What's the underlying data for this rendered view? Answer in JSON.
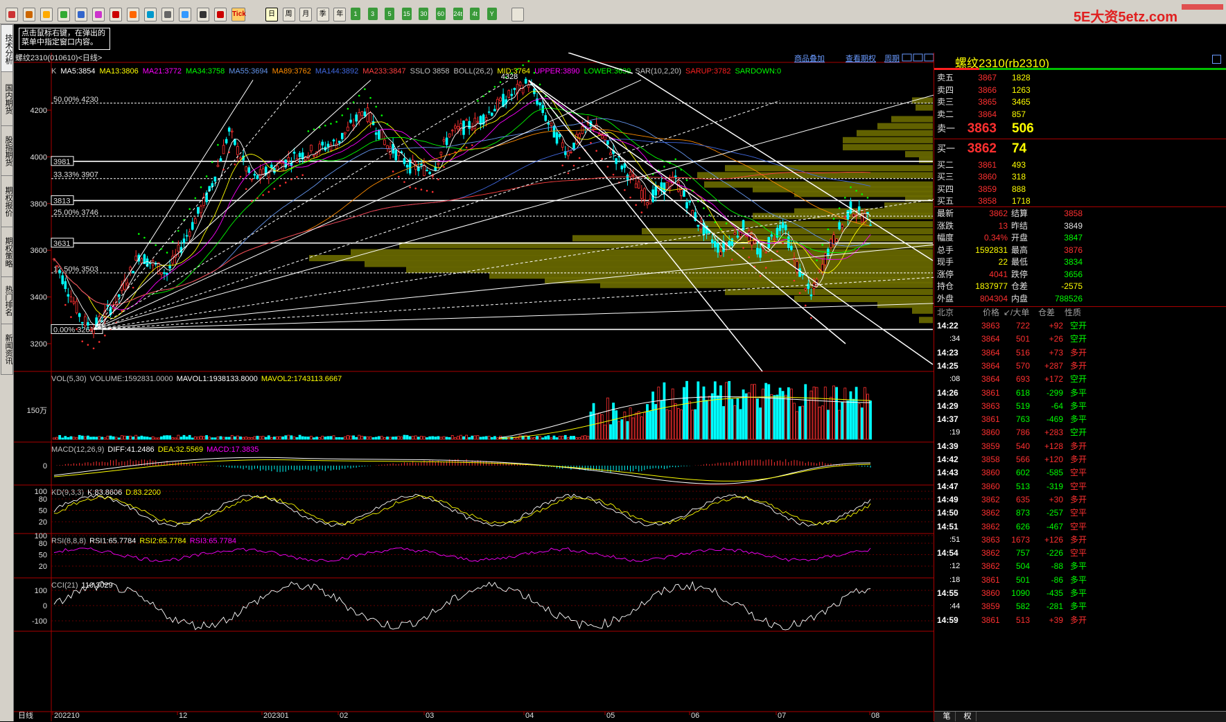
{
  "toolbar": {
    "icons": [
      "home-icon",
      "book-icon",
      "disk-icon",
      "refresh-icon",
      "zoom-in-icon",
      "zoom-out-icon",
      "draw-icon",
      "pen-icon",
      "filter-icon",
      "cursor-icon",
      "new-icon",
      "table-icon",
      "chart-icon",
      "tick-icon"
    ],
    "tick_label": "Tick",
    "periods": [
      "日",
      "周",
      "月",
      "季",
      "年",
      "1",
      "3",
      "5",
      "15",
      "30",
      "60",
      "24t",
      "4t",
      "Y"
    ],
    "brand": "5E大资5etz.com"
  },
  "left_tabs": [
    "技术分析",
    "国内期货",
    "股指期货",
    "期权报价",
    "期权策略",
    "热门排名",
    "新闻资讯"
  ],
  "tooltip": "点击鼠标右键，在弹出的菜单中指定窗口内容。",
  "chart": {
    "title": "螺纹2310(010610)<日线>",
    "top_links": [
      "商品叠加",
      "查看期权",
      "周期"
    ],
    "indicator_line": [
      {
        "text": "K",
        "color": "#c0c0c0"
      },
      {
        "text": "MA5:3854",
        "color": "#ffffff"
      },
      {
        "text": "MA13:3806",
        "color": "#ffff00"
      },
      {
        "text": "MA21:3772",
        "color": "#ff00ff"
      },
      {
        "text": "MA34:3758",
        "color": "#00ff00"
      },
      {
        "text": "MA55:3694",
        "color": "#6495ed"
      },
      {
        "text": "MA89:3762",
        "color": "#ff8c00"
      },
      {
        "text": "MA144:3892",
        "color": "#4169e1"
      },
      {
        "text": "MA233:3847",
        "color": "#ff4040"
      },
      {
        "text": "SSLO 3858",
        "color": "#c0c0c0"
      },
      {
        "text": "BOLL(26,2)",
        "color": "#c0c0c0"
      },
      {
        "text": "MID:3764",
        "color": "#ffff00"
      },
      {
        "text": "UPPER:3890",
        "color": "#ff00ff"
      },
      {
        "text": "LOWER:3639",
        "color": "#00ff00"
      },
      {
        "text": "SAR(10,2,20)",
        "color": "#c0c0c0"
      },
      {
        "text": "SARUP:3782",
        "color": "#ff2020"
      },
      {
        "text": "SARDOWN:0",
        "color": "#00ff00"
      }
    ],
    "price_axis": [
      "4200",
      "4000",
      "3800",
      "3600",
      "3400",
      "3200"
    ],
    "fib_labels": [
      "50.00% 4230",
      "3981",
      "33.33% 3907",
      "3813",
      "25.00% 3746",
      "3631",
      "12.50% 3503",
      "0.00% 3261"
    ],
    "fib_prices": [
      4230,
      3981,
      3907,
      3813,
      3746,
      3631,
      3503,
      3261
    ],
    "high_label": "4328",
    "high_price": 4328,
    "low_price": 3261,
    "date_axis": [
      "日线",
      "202210",
      "12",
      "202301",
      "02",
      "03",
      "04",
      "05",
      "06",
      "07",
      "08"
    ],
    "vol": {
      "title": "VOL(5,30)",
      "parts": [
        {
          "text": "VOL(5,30)",
          "color": "#c0c0c0"
        },
        {
          "text": "VOLUME:1592831.0000",
          "color": "#c0c0c0"
        },
        {
          "text": "MAVOL1:1938133.8000",
          "color": "#ffffff"
        },
        {
          "text": "MAVOL2:1743113.6667",
          "color": "#ffff00"
        }
      ],
      "axis": "150万"
    },
    "macd": {
      "parts": [
        {
          "text": "MACD(12,26,9)",
          "color": "#c0c0c0"
        },
        {
          "text": "DIFF:41.2486",
          "color": "#ffffff"
        },
        {
          "text": "DEA:32.5569",
          "color": "#ffff00"
        },
        {
          "text": "MACD:17.3835",
          "color": "#ff00ff"
        }
      ],
      "axis": "0"
    },
    "kd": {
      "parts": [
        {
          "text": "KD(9,3,3)",
          "color": "#c0c0c0"
        },
        {
          "text": "K:83.8606",
          "color": "#ffffff"
        },
        {
          "text": "D:83.2200",
          "color": "#ffff00"
        }
      ],
      "axis": [
        "100",
        "80",
        "50",
        "20"
      ]
    },
    "rsi": {
      "parts": [
        {
          "text": "RSI(8,8,8)",
          "color": "#c0c0c0"
        },
        {
          "text": "RSI1:65.7784",
          "color": "#ffffff"
        },
        {
          "text": "RSI2:65.7784",
          "color": "#ffff00"
        },
        {
          "text": "RSI3:65.7784",
          "color": "#ff00ff"
        }
      ],
      "axis": [
        "100",
        "80",
        "50",
        "20"
      ]
    },
    "cci": {
      "parts": [
        {
          "text": "CCI(21)",
          "color": "#c0c0c0"
        },
        {
          "text": "110.3029",
          "color": "#ffffff"
        }
      ],
      "axis": [
        "100",
        "0",
        "-100"
      ]
    }
  },
  "panel": {
    "title": "螺纹2310(rb2310)",
    "sells": [
      {
        "label": "卖五",
        "price": "3867",
        "vol": "1828"
      },
      {
        "label": "卖四",
        "price": "3866",
        "vol": "1263"
      },
      {
        "label": "卖三",
        "price": "3865",
        "vol": "3465"
      },
      {
        "label": "卖二",
        "price": "3864",
        "vol": "857"
      },
      {
        "label": "卖一",
        "price": "3863",
        "vol": "506"
      }
    ],
    "buys": [
      {
        "label": "买一",
        "price": "3862",
        "vol": "74"
      },
      {
        "label": "买二",
        "price": "3861",
        "vol": "493"
      },
      {
        "label": "买三",
        "price": "3860",
        "vol": "318"
      },
      {
        "label": "买四",
        "price": "3859",
        "vol": "888"
      },
      {
        "label": "买五",
        "price": "3858",
        "vol": "1718"
      }
    ],
    "stats": [
      {
        "l1": "最新",
        "v1": "3862",
        "c1": "#ff3030",
        "l2": "结算",
        "v2": "3858",
        "c2": "#ff3030"
      },
      {
        "l1": "涨跌",
        "v1": "13",
        "c1": "#ff3030",
        "l2": "昨结",
        "v2": "3849",
        "c2": "#e0e0e0"
      },
      {
        "l1": "幅度",
        "v1": "0.34%",
        "c1": "#ff3030",
        "l2": "开盘",
        "v2": "3847",
        "c2": "#00ff00"
      },
      {
        "l1": "总手",
        "v1": "1592831",
        "c1": "#ffff00",
        "l2": "最高",
        "v2": "3876",
        "c2": "#ff3030"
      },
      {
        "l1": "现手",
        "v1": "22",
        "c1": "#ffff00",
        "l2": "最低",
        "v2": "3834",
        "c2": "#00ff00"
      },
      {
        "l1": "涨停",
        "v1": "4041",
        "c1": "#ff3030",
        "l2": "跌停",
        "v2": "3656",
        "c2": "#00ff00"
      },
      {
        "l1": "持仓",
        "v1": "1837977",
        "c1": "#ffff00",
        "l2": "仓差",
        "v2": "-2575",
        "c2": "#ffff00"
      },
      {
        "l1": "外盘",
        "v1": "804304",
        "c1": "#ff3030",
        "l2": "内盘",
        "v2": "788526",
        "c2": "#00ff00"
      }
    ],
    "tick_header": [
      "北京",
      "价格",
      "↙/大单",
      "仓差",
      "性质"
    ],
    "ticks": [
      {
        "t": "14:22",
        "p": "3863",
        "v": "722",
        "d": "+92",
        "n": "空开"
      },
      {
        "t": ":34",
        "p": "3864",
        "v": "501",
        "d": "+26",
        "n": "空开"
      },
      {
        "t": "14:23",
        "p": "3864",
        "v": "516",
        "d": "+73",
        "n": "多开"
      },
      {
        "t": "14:25",
        "p": "3864",
        "v": "570",
        "d": "+287",
        "n": "多开"
      },
      {
        "t": ":08",
        "p": "3864",
        "v": "693",
        "d": "+172",
        "n": "空开"
      },
      {
        "t": "14:26",
        "p": "3861",
        "v": "618",
        "d": "-299",
        "n": "多平"
      },
      {
        "t": "14:29",
        "p": "3863",
        "v": "519",
        "d": "-64",
        "n": "多平"
      },
      {
        "t": "14:37",
        "p": "3861",
        "v": "763",
        "d": "-469",
        "n": "多平"
      },
      {
        "t": ":19",
        "p": "3860",
        "v": "786",
        "d": "+283",
        "n": "空开"
      },
      {
        "t": "14:39",
        "p": "3859",
        "v": "540",
        "d": "+128",
        "n": "多开"
      },
      {
        "t": "14:42",
        "p": "3858",
        "v": "566",
        "d": "+120",
        "n": "多开"
      },
      {
        "t": "14:43",
        "p": "3860",
        "v": "602",
        "d": "-585",
        "n": "空平"
      },
      {
        "t": "14:47",
        "p": "3860",
        "v": "513",
        "d": "-319",
        "n": "空平"
      },
      {
        "t": "14:49",
        "p": "3862",
        "v": "635",
        "d": "+30",
        "n": "多开"
      },
      {
        "t": "14:50",
        "p": "3862",
        "v": "873",
        "d": "-257",
        "n": "空平"
      },
      {
        "t": "14:51",
        "p": "3862",
        "v": "626",
        "d": "-467",
        "n": "空平"
      },
      {
        "t": ":51",
        "p": "3863",
        "v": "1673",
        "d": "+126",
        "n": "多开"
      },
      {
        "t": "14:54",
        "p": "3862",
        "v": "757",
        "d": "-226",
        "n": "空平"
      },
      {
        "t": ":12",
        "p": "3862",
        "v": "504",
        "d": "-88",
        "n": "多平"
      },
      {
        "t": ":18",
        "p": "3861",
        "v": "501",
        "d": "-86",
        "n": "多平"
      },
      {
        "t": "14:55",
        "p": "3860",
        "v": "1090",
        "d": "-435",
        "n": "多平"
      },
      {
        "t": ":44",
        "p": "3859",
        "v": "582",
        "d": "-281",
        "n": "多平"
      },
      {
        "t": "14:59",
        "p": "3861",
        "v": "513",
        "d": "+39",
        "n": "多开"
      }
    ],
    "bottom_tabs": [
      "笔",
      "权"
    ]
  }
}
